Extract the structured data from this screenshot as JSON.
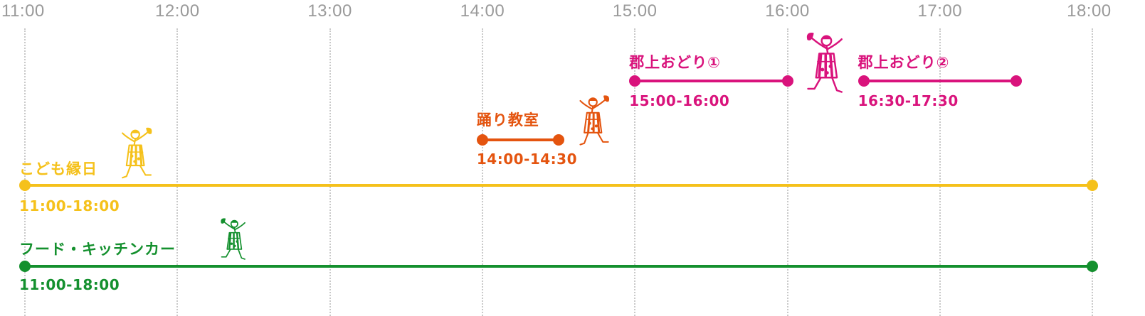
{
  "timeline": {
    "hours": [
      "11:00",
      "12:00",
      "13:00",
      "14:00",
      "15:00",
      "16:00",
      "17:00",
      "18:00"
    ]
  },
  "events": [
    {
      "id": "kids-fair",
      "title": "こども縁日",
      "time": "11:00-18:00",
      "start_hour": 11.0,
      "end_hour": 18.0,
      "color": "#f5c11b"
    },
    {
      "id": "food-truck",
      "title": "フード・キッチンカー",
      "time": "11:00-18:00",
      "start_hour": 11.0,
      "end_hour": 18.0,
      "color": "#14902e"
    },
    {
      "id": "dance-class",
      "title": "踊り教室",
      "time": "14:00-14:30",
      "start_hour": 14.0,
      "end_hour": 14.5,
      "color": "#e4540f"
    },
    {
      "id": "gujo-1",
      "title": "郡上おどり①",
      "time": "15:00-16:00",
      "start_hour": 15.0,
      "end_hour": 16.0,
      "color": "#d9137c"
    },
    {
      "id": "gujo-2",
      "title": "郡上おどり②",
      "time": "16:30-17:30",
      "start_hour": 16.5,
      "end_hour": 17.5,
      "color": "#d9137c"
    }
  ],
  "dancer_icons": [
    {
      "event": "kids-fair",
      "icon": "dancer-icon",
      "color": "#f5c11b"
    },
    {
      "event": "food-truck",
      "icon": "dancer-icon",
      "color": "#14902e"
    },
    {
      "event": "dance-class",
      "icon": "dancer-icon",
      "color": "#e4540f"
    },
    {
      "event": "gujo-1",
      "icon": "dancer-icon",
      "color": "#d9137c"
    }
  ]
}
